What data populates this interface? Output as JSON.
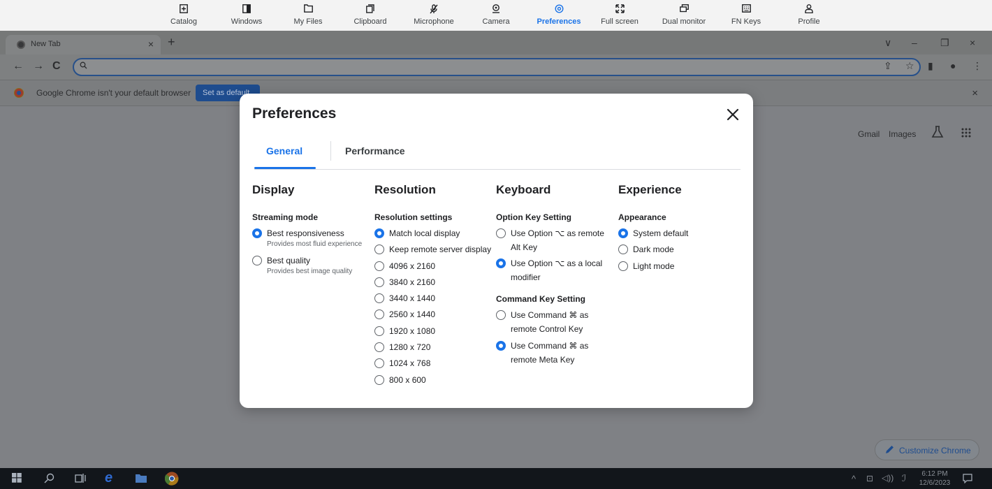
{
  "toolbar": {
    "items": [
      {
        "label": "Catalog",
        "icon": "catalog-icon",
        "active": false
      },
      {
        "label": "Windows",
        "icon": "windows-icon",
        "active": false
      },
      {
        "label": "My Files",
        "icon": "folder-icon",
        "active": false
      },
      {
        "label": "Clipboard",
        "icon": "clipboard-icon",
        "active": false
      },
      {
        "label": "Microphone",
        "icon": "microphone-off-icon",
        "active": false
      },
      {
        "label": "Camera",
        "icon": "camera-icon",
        "active": false
      },
      {
        "label": "Preferences",
        "icon": "gear-icon",
        "active": true
      },
      {
        "label": "Full screen",
        "icon": "fullscreen-icon",
        "active": false
      },
      {
        "label": "Dual monitor",
        "icon": "dual-monitor-icon",
        "active": false
      },
      {
        "label": "FN Keys",
        "icon": "keyboard-icon",
        "active": false
      },
      {
        "label": "Profile",
        "icon": "profile-icon",
        "active": false
      }
    ]
  },
  "browser": {
    "tab_title": "New Tab",
    "tab_close": "×",
    "new_tab": "+",
    "window_controls": [
      "∨",
      "–",
      "❐",
      "×"
    ],
    "omnibox_value": "",
    "infobar": {
      "text": "Google Chrome isn't your default browser",
      "button": "Set as default",
      "close": "×"
    },
    "ntp": {
      "gmail": "Gmail",
      "images": "Images",
      "customize": "Customize Chrome"
    }
  },
  "taskbar": {
    "time": "6:12 PM",
    "date": "12/6/2023"
  },
  "modal": {
    "title": "Preferences",
    "tabs": [
      {
        "label": "General",
        "active": true
      },
      {
        "label": "Performance",
        "active": false
      }
    ],
    "display": {
      "heading": "Display",
      "subheading": "Streaming mode",
      "options": [
        {
          "label": "Best responsiveness",
          "desc": "Provides most fluid experience",
          "selected": true
        },
        {
          "label": "Best quality",
          "desc": "Provides best image quality",
          "selected": false
        }
      ]
    },
    "resolution": {
      "heading": "Resolution",
      "subheading": "Resolution settings",
      "options": [
        {
          "label": "Match local display",
          "selected": true
        },
        {
          "label": "Keep remote server display",
          "selected": false
        },
        {
          "label": "4096 x 2160",
          "selected": false
        },
        {
          "label": "3840 x 2160",
          "selected": false
        },
        {
          "label": "3440 x 1440",
          "selected": false
        },
        {
          "label": "2560 x 1440",
          "selected": false
        },
        {
          "label": "1920 x 1080",
          "selected": false
        },
        {
          "label": "1280 x 720",
          "selected": false
        },
        {
          "label": "1024 x 768",
          "selected": false
        },
        {
          "label": "800 x 600",
          "selected": false
        }
      ]
    },
    "keyboard": {
      "heading": "Keyboard",
      "option_key": {
        "subheading": "Option Key Setting",
        "options": [
          {
            "label": "Use Option ⌥ as remote Alt Key",
            "selected": false
          },
          {
            "label": "Use Option ⌥ as a local modifier",
            "selected": true
          }
        ]
      },
      "command_key": {
        "subheading": "Command Key Setting",
        "options": [
          {
            "label": "Use Command ⌘ as remote Control Key",
            "selected": false
          },
          {
            "label": "Use Command ⌘ as remote Meta Key",
            "selected": true
          }
        ]
      }
    },
    "experience": {
      "heading": "Experience",
      "subheading": "Appearance",
      "options": [
        {
          "label": "System default",
          "selected": true
        },
        {
          "label": "Dark mode",
          "selected": false
        },
        {
          "label": "Light mode",
          "selected": false
        }
      ]
    }
  },
  "colors": {
    "accent": "#1a73e8",
    "overlay_gray": "#7f8185",
    "taskbar": "#12161b"
  }
}
